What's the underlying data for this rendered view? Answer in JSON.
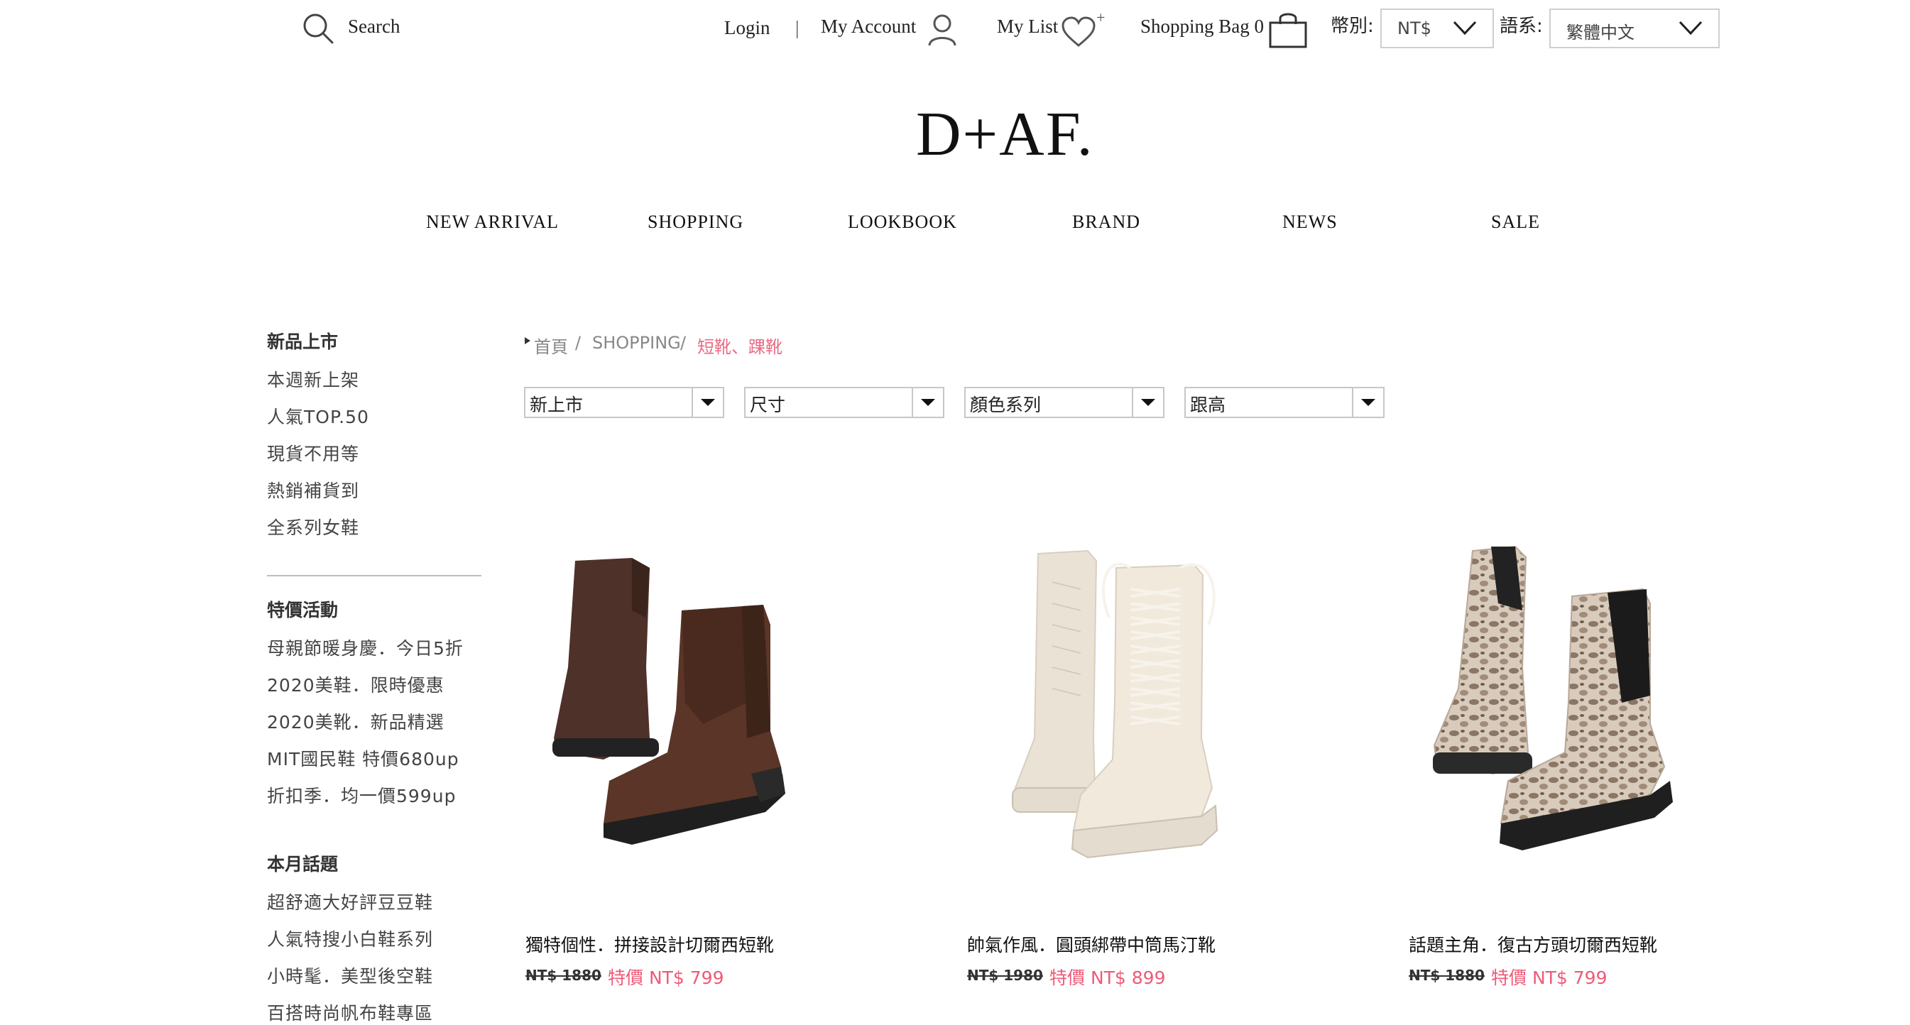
{
  "header": {
    "search_label": "Search",
    "login_label": "Login",
    "separator": "|",
    "account_label": "My Account",
    "mylist_label": "My List",
    "mylist_plus": "+",
    "bag_label": "Shopping Bag 0",
    "currency_label": "幣別:",
    "currency_value": "NT$",
    "language_label": "語系:",
    "language_value": "繁體中文"
  },
  "logo": "D+AF.",
  "nav": [
    "NEW ARRIVAL",
    "SHOPPING",
    "LOOKBOOK",
    "BRAND",
    "NEWS",
    "SALE"
  ],
  "sidebar": {
    "group1_title": "新品上市",
    "group1_items": [
      "本週新上架",
      "人氣TOP.50",
      "現貨不用等",
      "熱銷補貨到",
      "全系列女鞋"
    ],
    "group2_title": "特價活動",
    "group2_items": [
      "母親節暖身慶．今日5折",
      "2020美鞋．限時優惠",
      "2020美靴．新品精選",
      "MIT國民鞋 特價680up",
      "折扣季．均一價599up"
    ],
    "group3_title": "本月話題",
    "group3_items": [
      "超舒適大好評豆豆鞋",
      "人氣特搜小白鞋系列",
      "小時髦．美型後空鞋",
      "百搭時尚帆布鞋專區"
    ]
  },
  "breadcrumb": {
    "home": "首頁",
    "sep1": "/",
    "shopping": "SHOPPING",
    "sep2": "/",
    "current": "短靴、踝靴"
  },
  "filters": [
    "新上市",
    "尺寸",
    "顏色系列",
    "跟高"
  ],
  "products": [
    {
      "name": "獨特個性．拼接設計切爾西短靴",
      "old_price": "NT$ 1880",
      "sale_price": "特價 NT$ 799",
      "image": "brown-chelsea-boot"
    },
    {
      "name": "帥氣作風．圓頭綁帶中筒馬汀靴",
      "old_price": "NT$ 1980",
      "sale_price": "特價 NT$ 899",
      "image": "cream-lace-up-boot"
    },
    {
      "name": "話題主角．復古方頭切爾西短靴",
      "old_price": "NT$ 1880",
      "sale_price": "特價 NT$ 799",
      "image": "python-chelsea-boot"
    }
  ],
  "colors": {
    "accent": "#ee5a78",
    "breadcrumb_active": "#e86a84",
    "text": "#222222"
  }
}
